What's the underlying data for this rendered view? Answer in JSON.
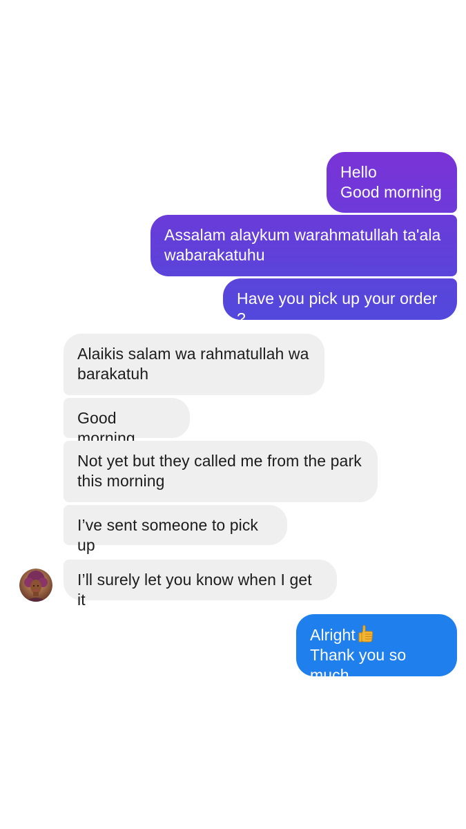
{
  "conversation": {
    "messages": [
      {
        "id": "out1",
        "direction": "outgoing",
        "text": "Hello\nGood morning"
      },
      {
        "id": "out2",
        "direction": "outgoing",
        "text": "Assalam alaykum warahmatullah ta'ala\nwabarakatuhu"
      },
      {
        "id": "out3",
        "direction": "outgoing",
        "text": "Have you pick up your order ?"
      },
      {
        "id": "in1",
        "direction": "incoming",
        "text": "Alaikis salam wa rahmatullah wa\nbarakatuh"
      },
      {
        "id": "in2",
        "direction": "incoming",
        "text": "Good morning"
      },
      {
        "id": "in3",
        "direction": "incoming",
        "text": "Not yet but they called me from the park\nthis morning"
      },
      {
        "id": "in4",
        "direction": "incoming",
        "text": "I’ve sent someone to pick up"
      },
      {
        "id": "in5",
        "direction": "incoming",
        "text": "I’ll surely let you know when I get it"
      },
      {
        "id": "out4",
        "direction": "outgoing",
        "line1": "Alright",
        "emoji": "thumbs-up-icon",
        "line2": "Thank you so much"
      }
    ]
  },
  "colors": {
    "outgoing_gradient_top": "#7a33d6",
    "outgoing_gradient_bottom": "#5248dc",
    "outgoing_blue": "#1f7fec",
    "incoming_bg": "#efefef",
    "incoming_text": "#1c1c1c"
  },
  "avatar": {
    "icon": "contact-avatar"
  }
}
